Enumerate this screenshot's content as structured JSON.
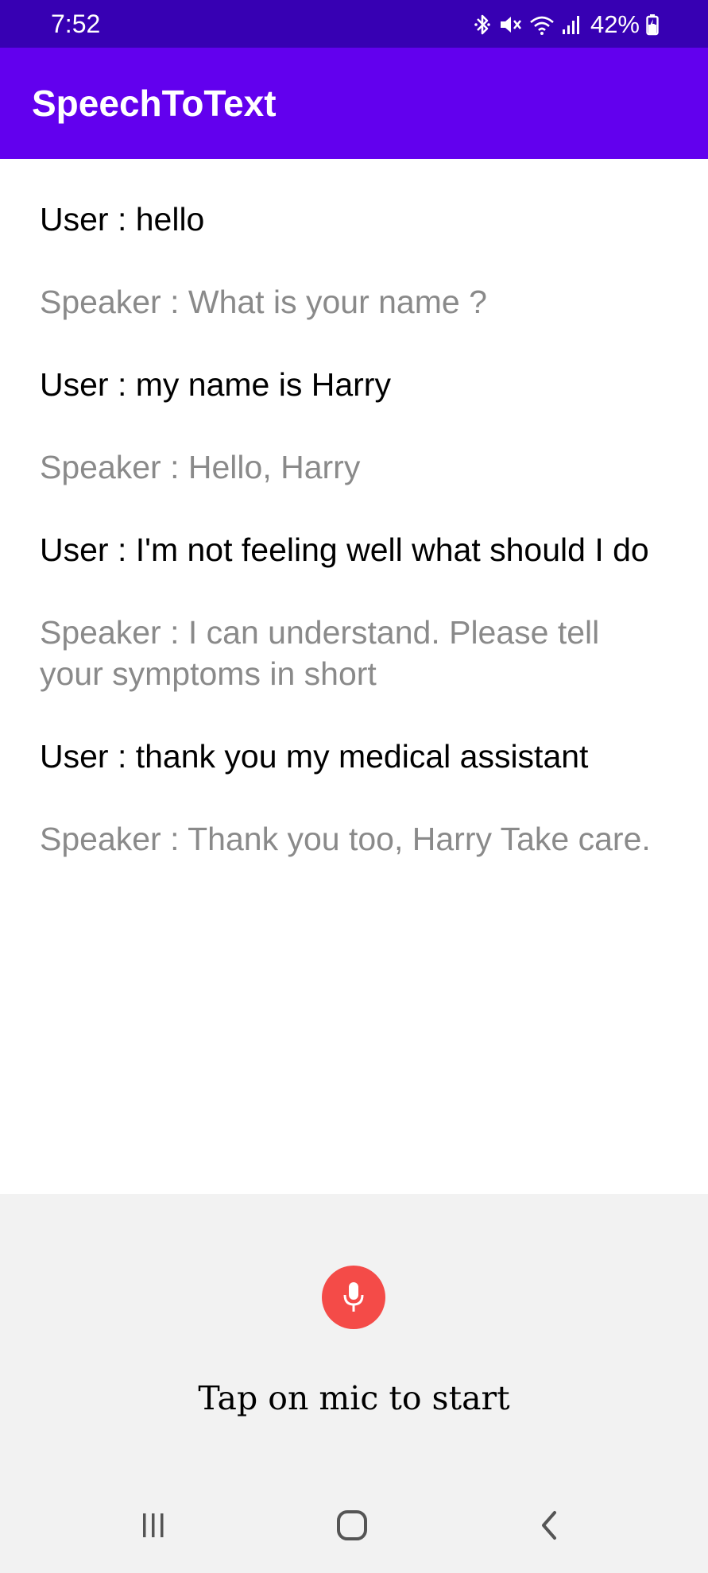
{
  "status_bar": {
    "time": "7:52",
    "battery": "42%",
    "icons": [
      "bluetooth-icon",
      "mute-icon",
      "wifi-icon",
      "signal-icon",
      "battery-charging-icon"
    ]
  },
  "app_bar": {
    "title": "SpeechToText"
  },
  "conversation": [
    {
      "role": "user",
      "text": "User : hello"
    },
    {
      "role": "speaker",
      "text": "Speaker : What is your name ?"
    },
    {
      "role": "user",
      "text": "User : my name is Harry"
    },
    {
      "role": "speaker",
      "text": "Speaker : Hello, Harry"
    },
    {
      "role": "user",
      "text": "User : I'm not feeling well what should I do"
    },
    {
      "role": "speaker",
      "text": "Speaker : I can understand. Please tell your symptoms in short"
    },
    {
      "role": "user",
      "text": "User : thank you my medical assistant"
    },
    {
      "role": "speaker",
      "text": "Speaker : Thank you too, Harry Take care."
    }
  ],
  "mic_panel": {
    "icon": "microphone-icon",
    "label": "Tap on mic to start"
  },
  "nav_bar": {
    "buttons": [
      "recent-apps-icon",
      "home-icon",
      "back-icon"
    ]
  },
  "colors": {
    "status_bar": "#3700B3",
    "app_bar": "#6200EE",
    "mic_button": "#f44b48",
    "user_text": "#000000",
    "speaker_text": "#8a8a8a",
    "panel_background": "#f2f2f2"
  }
}
